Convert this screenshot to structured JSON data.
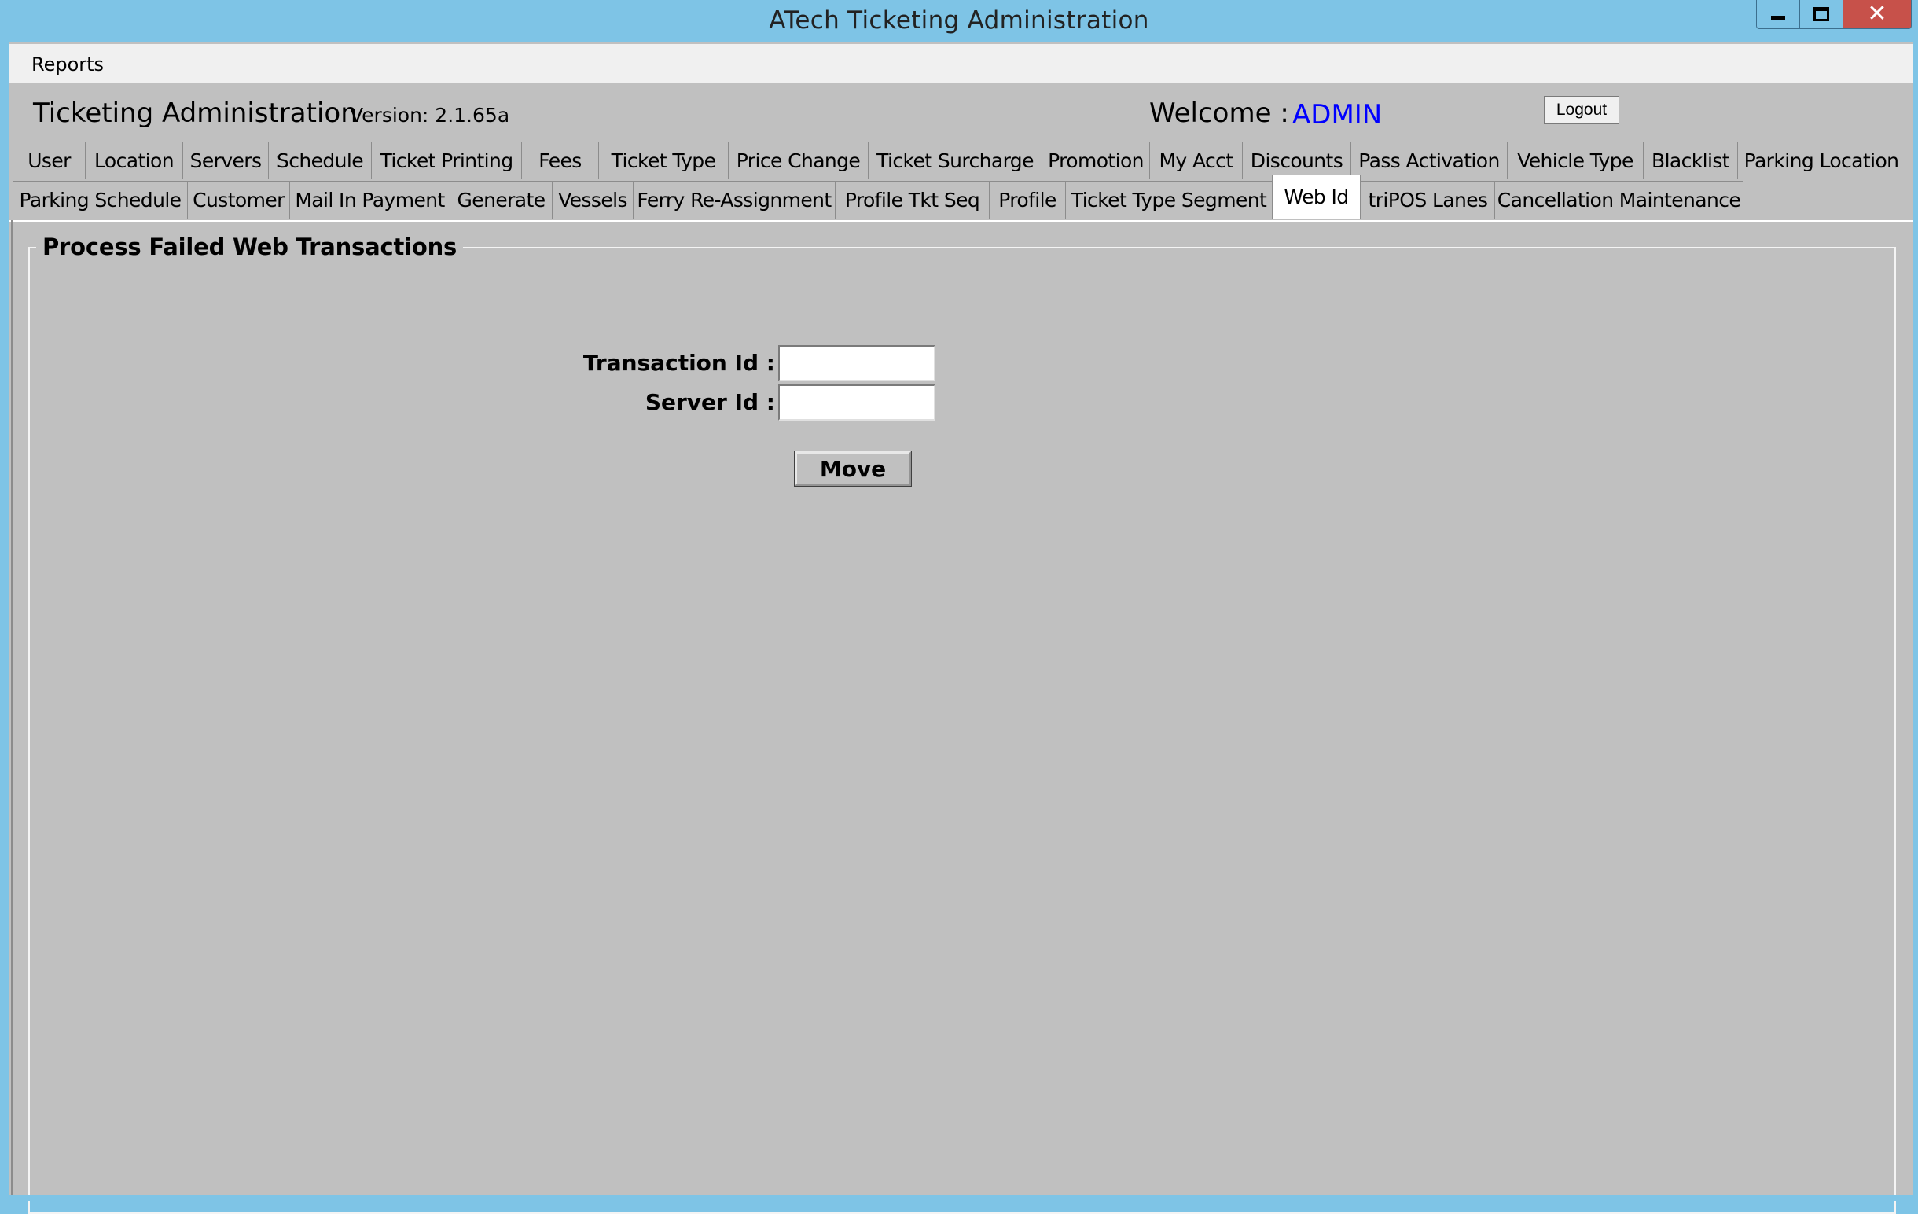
{
  "window": {
    "title": "ATech Ticketing Administration",
    "controls": [
      "minimize",
      "maximize",
      "close"
    ],
    "close_glyph": "✕"
  },
  "menu": {
    "items": [
      {
        "label": "Reports"
      }
    ]
  },
  "header": {
    "app_title": "Ticketing Administration",
    "version": "Version: 2.1.65a",
    "welcome_label": "Welcome :",
    "user": "ADMIN",
    "logout_label": "Logout"
  },
  "tabs": {
    "row1": [
      {
        "label": "User"
      },
      {
        "label": "Location"
      },
      {
        "label": "Servers"
      },
      {
        "label": "Schedule"
      },
      {
        "label": "Ticket Printing"
      },
      {
        "label": "Fees"
      },
      {
        "label": "Ticket Type"
      },
      {
        "label": "Price Change"
      },
      {
        "label": "Ticket Surcharge"
      },
      {
        "label": "Promotion"
      },
      {
        "label": "My Acct"
      },
      {
        "label": "Discounts"
      },
      {
        "label": "Pass Activation"
      },
      {
        "label": "Vehicle Type"
      },
      {
        "label": "Blacklist"
      },
      {
        "label": "Parking Location"
      }
    ],
    "row2": [
      {
        "label": "Parking Schedule"
      },
      {
        "label": "Customer"
      },
      {
        "label": "Mail In Payment"
      },
      {
        "label": "Generate"
      },
      {
        "label": "Vessels"
      },
      {
        "label": "Ferry Re-Assignment"
      },
      {
        "label": "Profile Tkt Seq"
      },
      {
        "label": "Profile"
      },
      {
        "label": "Ticket Type Segment"
      },
      {
        "label": "Web Id"
      },
      {
        "label": "triPOS Lanes"
      },
      {
        "label": "Cancellation Maintenance"
      }
    ],
    "active": "Web Id"
  },
  "panel": {
    "group_title": "Process Failed Web Transactions",
    "transaction_id_label": "Transaction Id :",
    "transaction_id_value": "",
    "server_id_label": "Server Id :",
    "server_id_value": "",
    "move_label": "Move"
  },
  "colors": {
    "titlebar": "#7ec4e6",
    "form_background": "#c0c0c0",
    "user_text": "#0000ff",
    "close_button": "#c7514a"
  }
}
